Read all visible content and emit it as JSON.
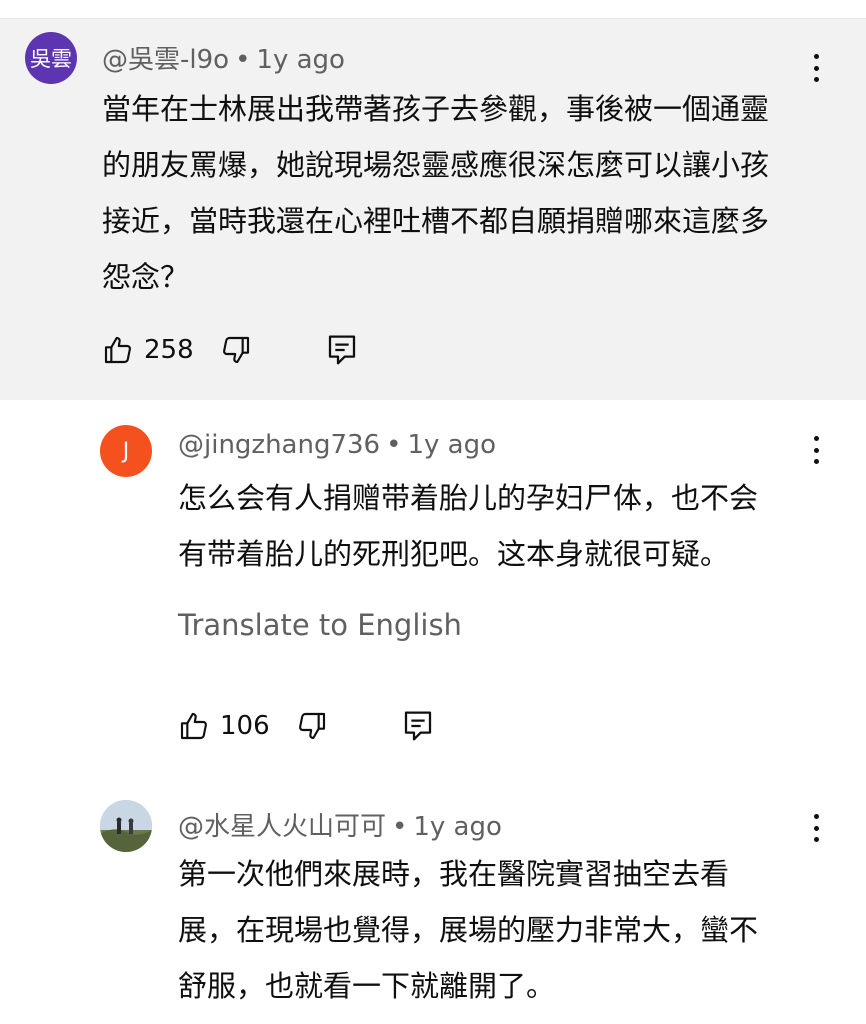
{
  "comments": [
    {
      "avatar_text": "吳雲",
      "avatar_color": "#5e35b1",
      "handle": "@吳雲-l9o",
      "time": "1y ago",
      "lines": [
        "當年在士林展出我帶著孩子去參觀，事後被一個通靈",
        "的朋友罵爆，她說現場怨靈感應很深怎麼可以讓小孩",
        "接近，當時我還在心裡吐槽不都自願捐贈哪來這麼多",
        "怨念？"
      ],
      "likes": "258"
    },
    {
      "avatar_text": "J",
      "avatar_color": "#f4511e",
      "handle": "@jingzhang736",
      "time": "1y ago",
      "lines": [
        "怎么会有人捐赠带着胎儿的孕妇尸体，也不会",
        "有带着胎儿的死刑犯吧。这本身就很可疑。"
      ],
      "translate": "Translate to English",
      "likes": "106"
    },
    {
      "avatar_text": "",
      "avatar_color": "#b8c7d6",
      "handle": "@水星人火山可可",
      "time": "1y ago",
      "lines": [
        "第一次他們來展時，我在醫院實習抽空去看",
        "展，在現場也覺得，展場的壓力非常大，蠻不",
        "舒服，也就看一下就離開了。"
      ]
    }
  ],
  "separator": "•"
}
